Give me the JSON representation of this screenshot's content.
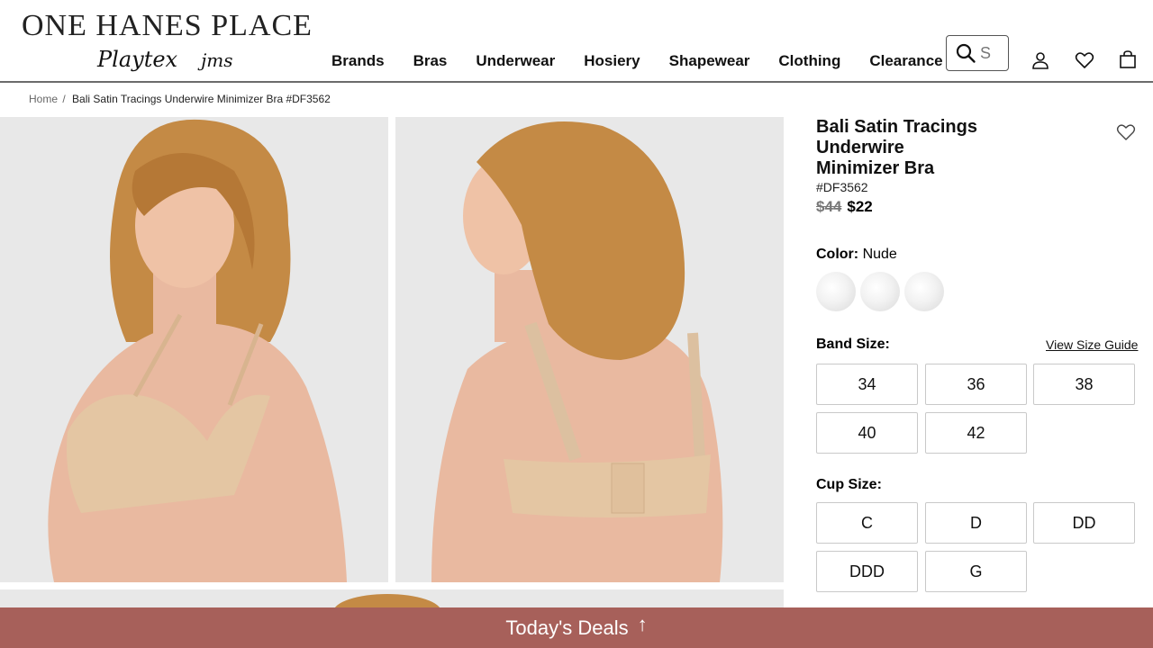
{
  "header": {
    "logo_main": "ONE HANES PLACE",
    "logo_sub_1": "Playtex",
    "logo_sub_2": "jms",
    "nav": [
      "Brands",
      "Bras",
      "Underwear",
      "Hosiery",
      "Shapewear",
      "Clothing",
      "Clearance"
    ],
    "search_value": "S"
  },
  "breadcrumb": {
    "home": "Home",
    "separator": "/",
    "current": "Bali Satin Tracings Underwire Minimizer Bra #DF3562"
  },
  "product": {
    "title_line1": "Bali Satin Tracings",
    "title_line2": "Underwire",
    "title_line3": "Minimizer Bra",
    "sku": "#DF3562",
    "original_price": "$44",
    "sale_price": "$22",
    "color_label": "Color:",
    "color_value": "Nude",
    "band_label": "Band Size:",
    "size_guide": "View Size Guide",
    "band_sizes": [
      "34",
      "36",
      "38",
      "40",
      "42"
    ],
    "cup_label": "Cup Size:",
    "cup_sizes": [
      "C",
      "D",
      "DD",
      "DDD",
      "G"
    ]
  },
  "deals_bar": {
    "label": "Today's Deals",
    "arrow": "↑"
  },
  "colors": {
    "deals_bar": "#a7605a",
    "photo_bg": "#e7e7e7",
    "bra_nude": "#e4c6a3",
    "hair": "#c48a45"
  }
}
